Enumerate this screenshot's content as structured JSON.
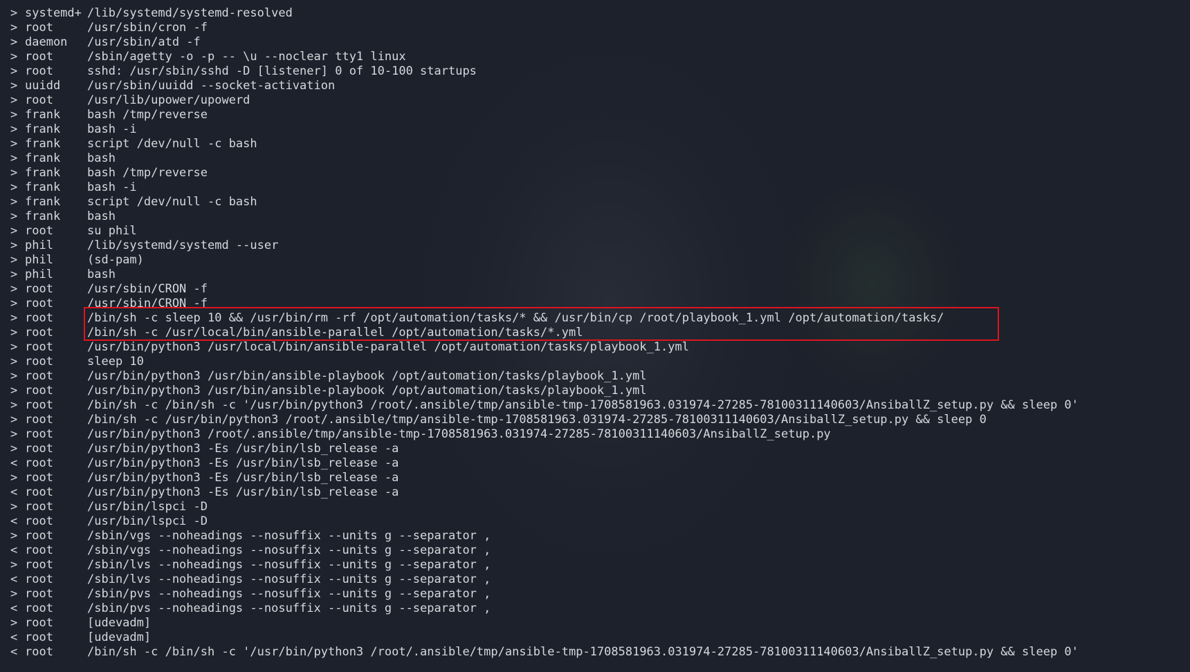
{
  "colors": {
    "background": "#1d212b",
    "text": "#d6d9de",
    "highlight_border": "#e0141e"
  },
  "terminal": {
    "lines": [
      {
        "dir": ">",
        "user": "systemd+",
        "cmd": "/lib/systemd/systemd-resolved"
      },
      {
        "dir": ">",
        "user": "root",
        "cmd": "/usr/sbin/cron -f"
      },
      {
        "dir": ">",
        "user": "daemon",
        "cmd": "/usr/sbin/atd -f"
      },
      {
        "dir": ">",
        "user": "root",
        "cmd": "/sbin/agetty -o -p -- \\u --noclear tty1 linux"
      },
      {
        "dir": ">",
        "user": "root",
        "cmd": "sshd: /usr/sbin/sshd -D [listener] 0 of 10-100 startups"
      },
      {
        "dir": ">",
        "user": "uuidd",
        "cmd": "/usr/sbin/uuidd --socket-activation"
      },
      {
        "dir": ">",
        "user": "root",
        "cmd": "/usr/lib/upower/upowerd"
      },
      {
        "dir": ">",
        "user": "frank",
        "cmd": "bash /tmp/reverse"
      },
      {
        "dir": ">",
        "user": "frank",
        "cmd": "bash -i"
      },
      {
        "dir": ">",
        "user": "frank",
        "cmd": "script /dev/null -c bash"
      },
      {
        "dir": ">",
        "user": "frank",
        "cmd": "bash"
      },
      {
        "dir": ">",
        "user": "frank",
        "cmd": "bash /tmp/reverse"
      },
      {
        "dir": ">",
        "user": "frank",
        "cmd": "bash -i"
      },
      {
        "dir": ">",
        "user": "frank",
        "cmd": "script /dev/null -c bash"
      },
      {
        "dir": ">",
        "user": "frank",
        "cmd": "bash"
      },
      {
        "dir": ">",
        "user": "root",
        "cmd": "su phil"
      },
      {
        "dir": ">",
        "user": "phil",
        "cmd": "/lib/systemd/systemd --user"
      },
      {
        "dir": ">",
        "user": "phil",
        "cmd": "(sd-pam)"
      },
      {
        "dir": ">",
        "user": "phil",
        "cmd": "bash"
      },
      {
        "dir": ">",
        "user": "root",
        "cmd": "/usr/sbin/CRON -f"
      },
      {
        "dir": ">",
        "user": "root",
        "cmd": "/usr/sbin/CRON -f"
      },
      {
        "dir": ">",
        "user": "root",
        "cmd": "/bin/sh -c sleep 10 && /usr/bin/rm -rf /opt/automation/tasks/* && /usr/bin/cp /root/playbook_1.yml /opt/automation/tasks/"
      },
      {
        "dir": ">",
        "user": "root",
        "cmd": "/bin/sh -c /usr/local/bin/ansible-parallel /opt/automation/tasks/*.yml"
      },
      {
        "dir": ">",
        "user": "root",
        "cmd": "/usr/bin/python3 /usr/local/bin/ansible-parallel /opt/automation/tasks/playbook_1.yml"
      },
      {
        "dir": ">",
        "user": "root",
        "cmd": "sleep 10"
      },
      {
        "dir": ">",
        "user": "root",
        "cmd": "/usr/bin/python3 /usr/bin/ansible-playbook /opt/automation/tasks/playbook_1.yml"
      },
      {
        "dir": ">",
        "user": "root",
        "cmd": "/usr/bin/python3 /usr/bin/ansible-playbook /opt/automation/tasks/playbook_1.yml"
      },
      {
        "dir": ">",
        "user": "root",
        "cmd": "/bin/sh -c /bin/sh -c '/usr/bin/python3 /root/.ansible/tmp/ansible-tmp-1708581963.031974-27285-78100311140603/AnsiballZ_setup.py && sleep 0'"
      },
      {
        "dir": ">",
        "user": "root",
        "cmd": "/bin/sh -c /usr/bin/python3 /root/.ansible/tmp/ansible-tmp-1708581963.031974-27285-78100311140603/AnsiballZ_setup.py && sleep 0"
      },
      {
        "dir": ">",
        "user": "root",
        "cmd": "/usr/bin/python3 /root/.ansible/tmp/ansible-tmp-1708581963.031974-27285-78100311140603/AnsiballZ_setup.py"
      },
      {
        "dir": ">",
        "user": "root",
        "cmd": "/usr/bin/python3 -Es /usr/bin/lsb_release -a"
      },
      {
        "dir": "<",
        "user": "root",
        "cmd": "/usr/bin/python3 -Es /usr/bin/lsb_release -a"
      },
      {
        "dir": ">",
        "user": "root",
        "cmd": "/usr/bin/python3 -Es /usr/bin/lsb_release -a"
      },
      {
        "dir": "<",
        "user": "root",
        "cmd": "/usr/bin/python3 -Es /usr/bin/lsb_release -a"
      },
      {
        "dir": ">",
        "user": "root",
        "cmd": "/usr/bin/lspci -D"
      },
      {
        "dir": "<",
        "user": "root",
        "cmd": "/usr/bin/lspci -D"
      },
      {
        "dir": ">",
        "user": "root",
        "cmd": "/sbin/vgs --noheadings --nosuffix --units g --separator ,"
      },
      {
        "dir": "<",
        "user": "root",
        "cmd": "/sbin/vgs --noheadings --nosuffix --units g --separator ,"
      },
      {
        "dir": ">",
        "user": "root",
        "cmd": "/sbin/lvs --noheadings --nosuffix --units g --separator ,"
      },
      {
        "dir": "<",
        "user": "root",
        "cmd": "/sbin/lvs --noheadings --nosuffix --units g --separator ,"
      },
      {
        "dir": ">",
        "user": "root",
        "cmd": "/sbin/pvs --noheadings --nosuffix --units g --separator ,"
      },
      {
        "dir": "<",
        "user": "root",
        "cmd": "/sbin/pvs --noheadings --nosuffix --units g --separator ,"
      },
      {
        "dir": ">",
        "user": "root",
        "cmd": "[udevadm]"
      },
      {
        "dir": "<",
        "user": "root",
        "cmd": "[udevadm]"
      },
      {
        "dir": "<",
        "user": "root",
        "cmd": "/bin/sh -c /bin/sh -c '/usr/bin/python3 /root/.ansible/tmp/ansible-tmp-1708581963.031974-27285-78100311140603/AnsiballZ_setup.py && sleep 0'"
      }
    ]
  }
}
